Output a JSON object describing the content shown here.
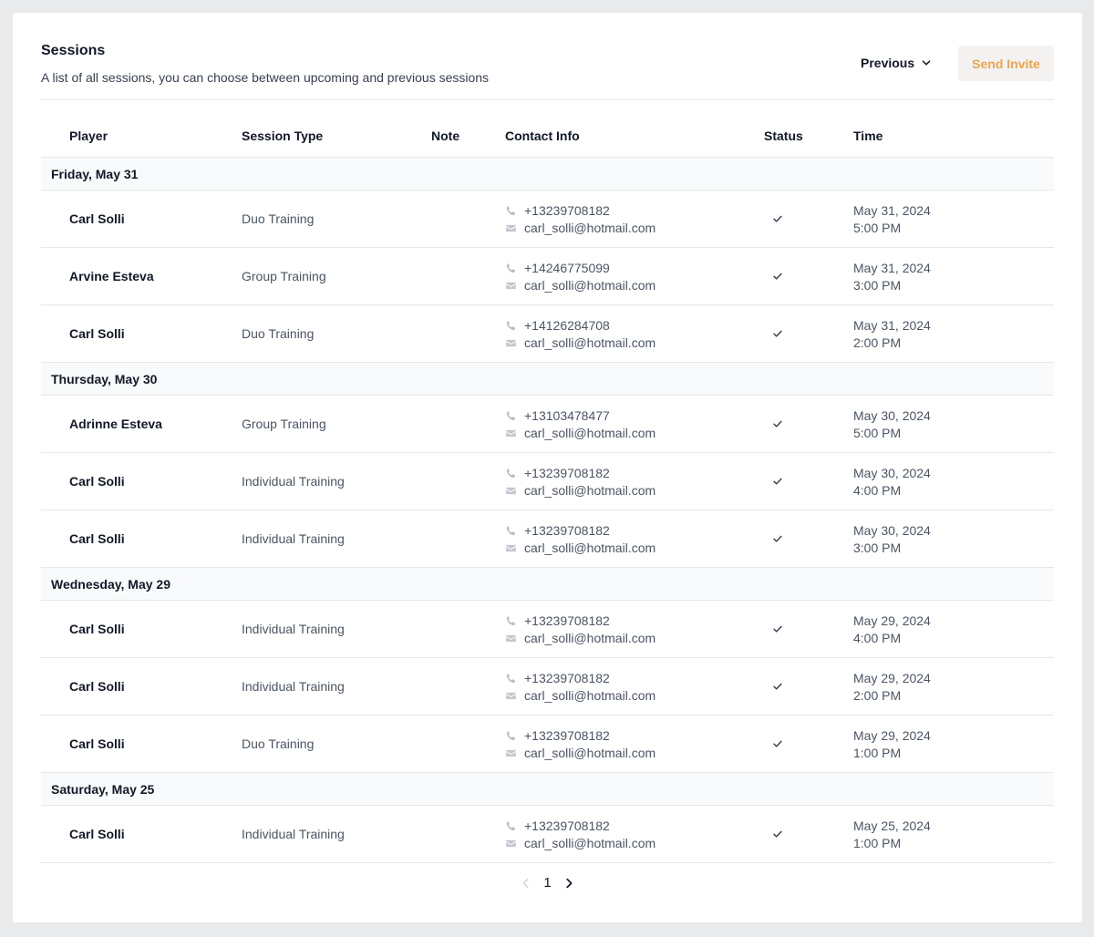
{
  "header": {
    "title": "Sessions",
    "subtitle": "A list of all sessions, you can choose between upcoming and previous sessions",
    "filter_label": "Previous",
    "invite_label": "Send Invite"
  },
  "colors": {
    "accent": "#eaa550",
    "row_border": "#e5e7eb",
    "group_bg": "#f9fafb"
  },
  "table": {
    "columns": [
      "Player",
      "Session Type",
      "Note",
      "Contact Info",
      "Status",
      "Time"
    ],
    "groups": [
      {
        "label": "Friday, May 31",
        "rows": [
          {
            "player": "Carl Solli",
            "type": "Duo Training",
            "phone": "+13239708182",
            "email": "carl_solli@hotmail.com",
            "date": "May 31, 2024",
            "time": "5:00 PM"
          },
          {
            "player": "Arvine Esteva",
            "type": "Group Training",
            "phone": "+14246775099",
            "email": "carl_solli@hotmail.com",
            "date": "May 31, 2024",
            "time": "3:00 PM"
          },
          {
            "player": "Carl Solli",
            "type": "Duo Training",
            "phone": "+14126284708",
            "email": "carl_solli@hotmail.com",
            "date": "May 31, 2024",
            "time": "2:00 PM"
          }
        ]
      },
      {
        "label": "Thursday, May 30",
        "rows": [
          {
            "player": "Adrinne Esteva",
            "type": "Group Training",
            "phone": "+13103478477",
            "email": "carl_solli@hotmail.com",
            "date": "May 30, 2024",
            "time": "5:00 PM"
          },
          {
            "player": "Carl Solli",
            "type": "Individual Training",
            "phone": "+13239708182",
            "email": "carl_solli@hotmail.com",
            "date": "May 30, 2024",
            "time": "4:00 PM"
          },
          {
            "player": "Carl Solli",
            "type": "Individual Training",
            "phone": "+13239708182",
            "email": "carl_solli@hotmail.com",
            "date": "May 30, 2024",
            "time": "3:00 PM"
          }
        ]
      },
      {
        "label": "Wednesday, May 29",
        "rows": [
          {
            "player": "Carl Solli",
            "type": "Individual Training",
            "phone": "+13239708182",
            "email": "carl_solli@hotmail.com",
            "date": "May 29, 2024",
            "time": "4:00 PM"
          },
          {
            "player": "Carl Solli",
            "type": "Individual Training",
            "phone": "+13239708182",
            "email": "carl_solli@hotmail.com",
            "date": "May 29, 2024",
            "time": "2:00 PM"
          },
          {
            "player": "Carl Solli",
            "type": "Duo Training",
            "phone": "+13239708182",
            "email": "carl_solli@hotmail.com",
            "date": "May 29, 2024",
            "time": "1:00 PM"
          }
        ]
      },
      {
        "label": "Saturday, May 25",
        "rows": [
          {
            "player": "Carl Solli",
            "type": "Individual Training",
            "phone": "+13239708182",
            "email": "carl_solli@hotmail.com",
            "date": "May 25, 2024",
            "time": "1:00 PM"
          }
        ]
      }
    ]
  },
  "pagination": {
    "current_page": "1"
  },
  "icons": {
    "phone": "phone-icon",
    "email": "mail-icon",
    "status": "check-icon",
    "filter": "chevron-down-icon",
    "prev": "chevron-left-icon",
    "next": "chevron-right-icon"
  }
}
